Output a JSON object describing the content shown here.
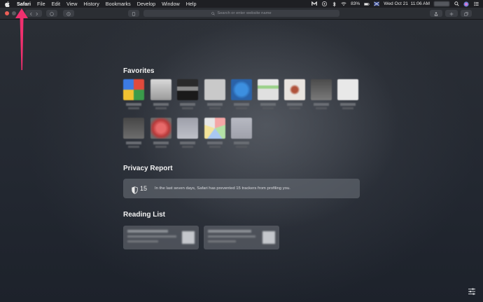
{
  "menubar": {
    "apple_icon": "apple-logo-icon",
    "items": [
      "Safari",
      "File",
      "Edit",
      "View",
      "History",
      "Bookmarks",
      "Develop",
      "Window",
      "Help"
    ],
    "status": {
      "battery": "83%",
      "datetime": "Wed Oct 21  11:06 AM"
    }
  },
  "toolbar": {
    "address_placeholder": "Search or enter website name"
  },
  "favorites": {
    "title": "Favorites",
    "tiles": [
      {
        "name": "favorite-1",
        "color": "#c8c8c8"
      },
      {
        "name": "favorite-2",
        "color": "#b8b8b8"
      },
      {
        "name": "favorite-3",
        "color": "#1c1c1c"
      },
      {
        "name": "favorite-4",
        "color": "#c9c9c9"
      },
      {
        "name": "favorite-5",
        "color": "#2e74c0"
      },
      {
        "name": "favorite-6",
        "color": "#dfe4d8"
      },
      {
        "name": "favorite-7",
        "color": "#e9e4df"
      },
      {
        "name": "favorite-8",
        "color": "#646464"
      },
      {
        "name": "favorite-9",
        "color": "#e8e8e8"
      },
      {
        "name": "favorite-10",
        "color": "#5e5e5e"
      },
      {
        "name": "favorite-11",
        "color": "#d44a4a"
      },
      {
        "name": "favorite-12",
        "color": "#9ea0aa"
      },
      {
        "name": "favorite-13",
        "color": "#dcdcdc"
      },
      {
        "name": "favorite-14",
        "color": "#a7a9b3"
      }
    ]
  },
  "privacy_report": {
    "title": "Privacy Report",
    "count": "15",
    "text": "In the last seven days, Safari has prevented 15 trackers from profiling you."
  },
  "reading_list": {
    "title": "Reading List"
  },
  "colors": {
    "annotation_arrow": "#f0306e",
    "close": "#ec5f57",
    "minimize": "#5a5c60",
    "zoom": "#5a5c60"
  }
}
